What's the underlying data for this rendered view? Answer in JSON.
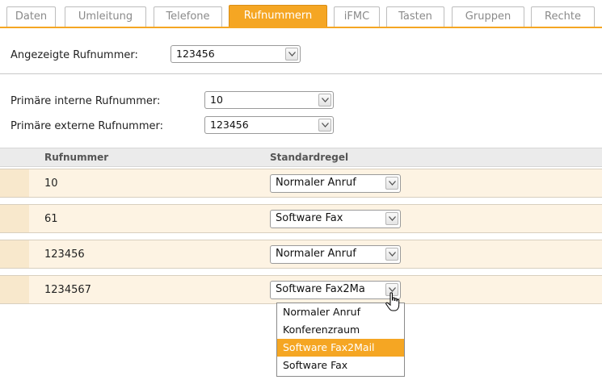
{
  "tabs": [
    {
      "label": "Daten",
      "active": false
    },
    {
      "label": "Umleitung",
      "active": false
    },
    {
      "label": "Telefone",
      "active": false
    },
    {
      "label": "Rufnummern",
      "active": true
    },
    {
      "label": "iFMC",
      "active": false
    },
    {
      "label": "Tasten",
      "active": false
    },
    {
      "label": "Gruppen",
      "active": false
    },
    {
      "label": "Rechte",
      "active": false
    }
  ],
  "displayed_number": {
    "label": "Angezeigte Rufnummer:",
    "value": "123456"
  },
  "primary_internal": {
    "label": "Primäre interne Rufnummer:",
    "value": "10"
  },
  "primary_external": {
    "label": "Primäre externe Rufnummer:",
    "value": "123456"
  },
  "table": {
    "headers": [
      "Rufnummer",
      "Standardregel"
    ],
    "rows": [
      {
        "number": "10",
        "rule": "Normaler Anruf"
      },
      {
        "number": "61",
        "rule": "Software Fax"
      },
      {
        "number": "123456",
        "rule": "Normaler Anruf"
      },
      {
        "number": "1234567",
        "rule": "Software Fax2Ma"
      }
    ]
  },
  "dropdown": {
    "options": [
      "Normaler Anruf",
      "Konferenzraum",
      "Software Fax2Mail",
      "Software Fax"
    ],
    "highlighted": "Software Fax2Mail"
  },
  "colors": {
    "accent": "#f5a623",
    "row_bg": "#fdf3e3"
  }
}
